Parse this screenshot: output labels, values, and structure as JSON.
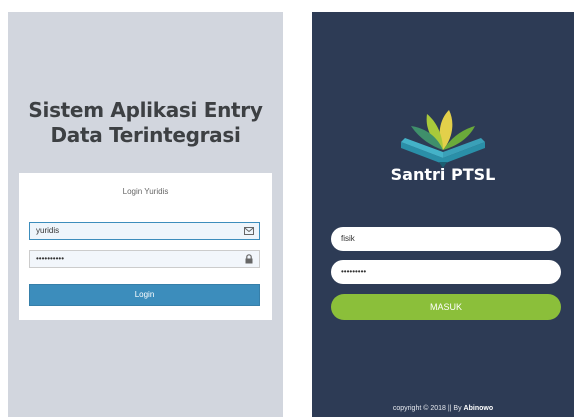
{
  "left_app": {
    "title": "Sistem Aplikasi Entry\nData Terintegrasi",
    "form_heading": "Login Yuridis",
    "username_value": "yuridis",
    "password_value": "••••••••••",
    "login_button": "Login",
    "icons": {
      "username": "envelope-icon",
      "password": "lock-icon"
    },
    "colors": {
      "background": "#d2d6de",
      "button": "#3c8dbc"
    }
  },
  "right_app": {
    "brand": "Santri PTSL",
    "username_value": "fisik",
    "password_value": "•••••••••",
    "submit_button": "MASUK",
    "copyright_text": "copyright © 2018 || By ",
    "copyright_author": "Abinowo",
    "logo_icon": "open-book-logo-icon",
    "colors": {
      "background": "#2d3b55",
      "button": "#8bbf3a"
    }
  }
}
